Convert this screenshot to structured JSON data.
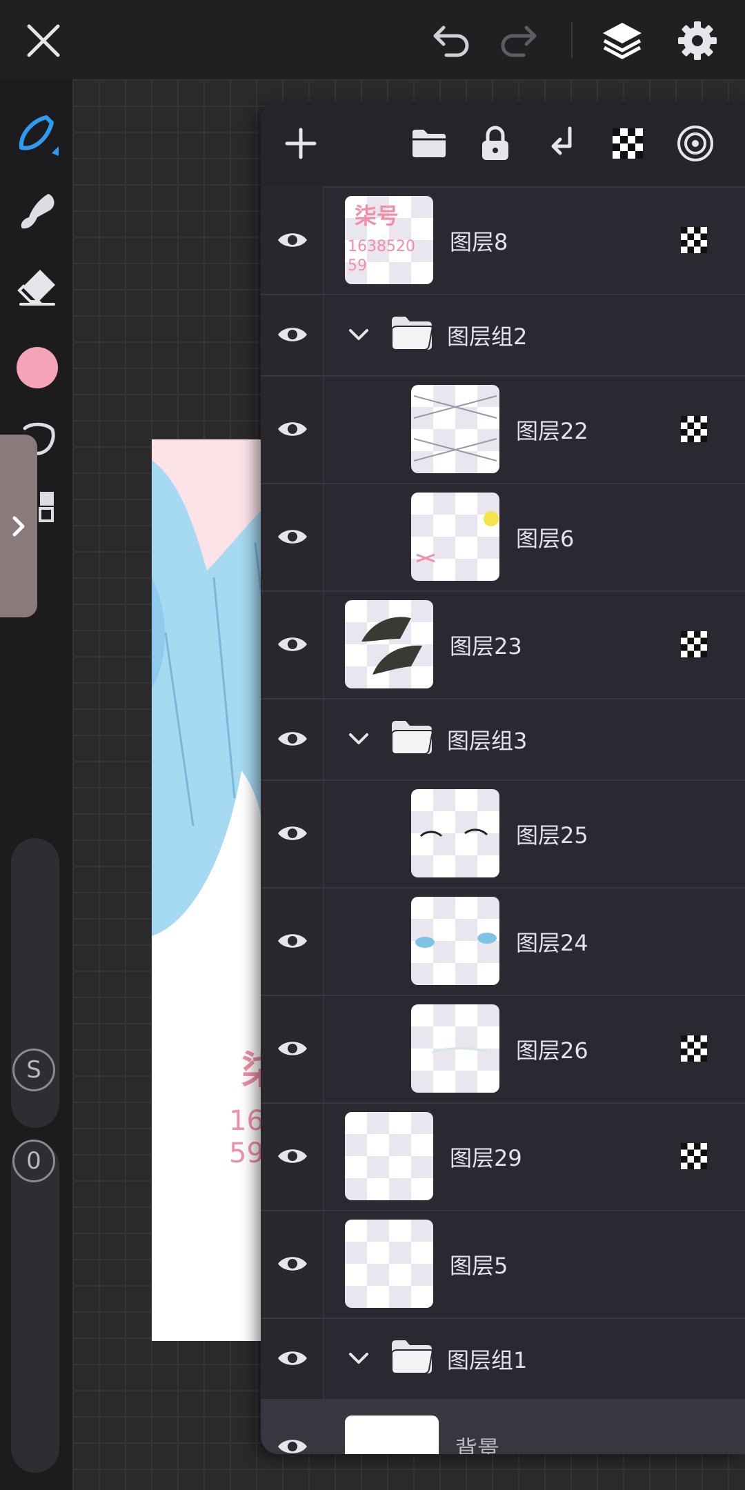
{
  "top_bar": {
    "close": "close",
    "undo": "undo",
    "redo": "redo",
    "layers": "layers",
    "settings": "settings"
  },
  "left_toolbar": {
    "tools": [
      "brush-tool",
      "smudge-tool",
      "eraser-tool",
      "color-swatch",
      "selection-tool",
      "layout-tool"
    ],
    "color": "#f5a3b8",
    "buttons": [
      {
        "label": "S"
      },
      {
        "label": "0"
      }
    ]
  },
  "artboard": {
    "watermark_title": "柒号",
    "watermark_number_line1": "1638520",
    "watermark_number_line2": "59"
  },
  "layers_panel": {
    "toolbar_icons": [
      "add-layer-icon",
      "folder-icon",
      "lock-icon",
      "merge-down-icon",
      "alpha-lock-icon",
      "blend-icon"
    ],
    "layers": [
      {
        "name": "图层8",
        "type": "layer",
        "indent": 0,
        "alpha_lock": true,
        "thumb": "watermark"
      },
      {
        "name": "图层组2",
        "type": "group",
        "indent": 0,
        "expanded": true
      },
      {
        "name": "图层22",
        "type": "layer",
        "indent": 1,
        "alpha_lock": true,
        "thumb": "lines"
      },
      {
        "name": "图层6",
        "type": "layer",
        "indent": 1,
        "alpha_lock": false,
        "thumb": "sticker"
      },
      {
        "name": "图层23",
        "type": "layer",
        "indent": 0,
        "alpha_lock": true,
        "thumb": "dark-shapes"
      },
      {
        "name": "图层组3",
        "type": "group",
        "indent": 0,
        "expanded": true
      },
      {
        "name": "图层25",
        "type": "layer",
        "indent": 1,
        "alpha_lock": false,
        "thumb": "eyes-outline"
      },
      {
        "name": "图层24",
        "type": "layer",
        "indent": 1,
        "alpha_lock": false,
        "thumb": "eyes-blue"
      },
      {
        "name": "图层26",
        "type": "layer",
        "indent": 1,
        "alpha_lock": true,
        "thumb": "faint"
      },
      {
        "name": "图层29",
        "type": "layer",
        "indent": 0,
        "alpha_lock": true,
        "thumb": "empty"
      },
      {
        "name": "图层5",
        "type": "layer",
        "indent": 0,
        "alpha_lock": false,
        "thumb": "empty"
      },
      {
        "name": "图层组1",
        "type": "group",
        "indent": 0,
        "expanded": true
      },
      {
        "name": "背景",
        "type": "background",
        "indent": 0,
        "alpha_lock": false,
        "thumb": "white"
      }
    ]
  }
}
